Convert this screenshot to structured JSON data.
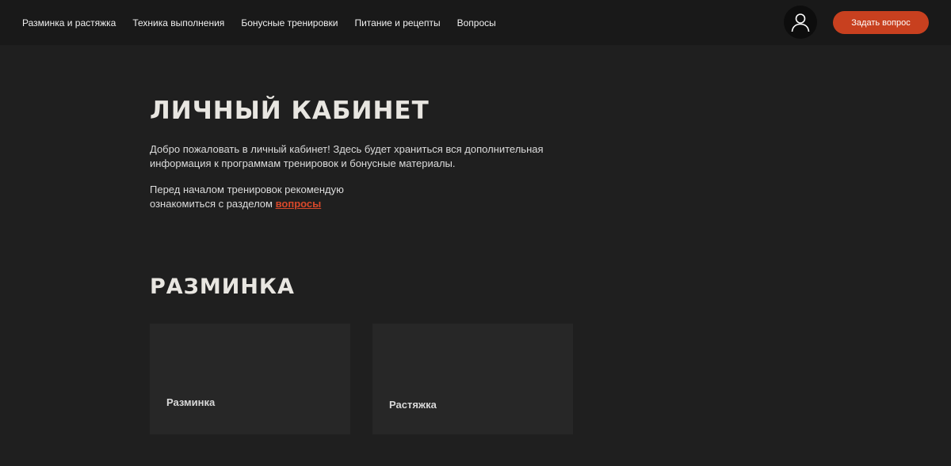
{
  "nav": {
    "items": [
      {
        "label": "Разминка и растяжка"
      },
      {
        "label": "Техника выполнения"
      },
      {
        "label": "Бонусные тренировки"
      },
      {
        "label": "Питание и рецепты"
      },
      {
        "label": "Вопросы"
      }
    ]
  },
  "header": {
    "avatar_icon": "user-icon",
    "ask_button": "Задать вопрос"
  },
  "main": {
    "title": "ЛИЧНЫЙ КАБИНЕТ",
    "welcome_text": "Добро пожаловать в личный кабинет! Здесь будет храниться вся дополнительная информация к программам тренировок и бонусные материалы.",
    "before_text": "Перед началом тренировок рекомендую ознакомиться с разделом ",
    "before_link": "вопросы"
  },
  "section": {
    "title": "РАЗМИНКА",
    "cards": [
      {
        "label": "Разминка"
      },
      {
        "label": "Растяжка"
      }
    ]
  },
  "colors": {
    "background": "#1f1f1f",
    "header": "#191919",
    "accent": "#c8401f",
    "card": "#272727"
  }
}
